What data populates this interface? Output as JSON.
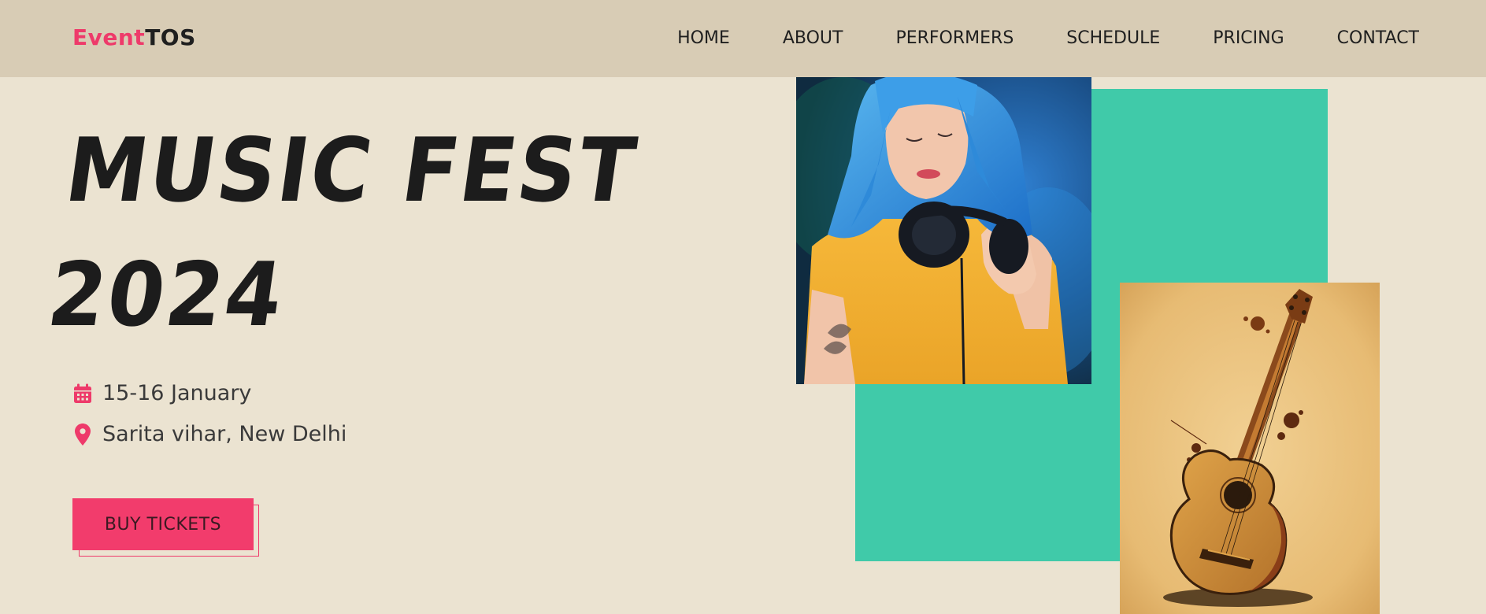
{
  "brand": {
    "part1": "Event",
    "part2": "TOS"
  },
  "nav": {
    "items": [
      {
        "label": "HOME"
      },
      {
        "label": "ABOUT"
      },
      {
        "label": "PERFORMERS"
      },
      {
        "label": "SCHEDULE"
      },
      {
        "label": "PRICING"
      },
      {
        "label": "CONTACT"
      }
    ]
  },
  "hero": {
    "title_line1": "MUSIC FEST",
    "title_line2": "2024",
    "date": "15-16 January",
    "location": "Sarita vihar, New Delhi",
    "cta_label": "BUY TICKETS",
    "date_icon": "calendar-icon",
    "location_icon": "map-pin-icon"
  },
  "colors": {
    "accent": "#f23c6c",
    "nav_bg": "#d8ccb5",
    "page_bg": "#ebe3d1",
    "teal": "#40caa9"
  }
}
